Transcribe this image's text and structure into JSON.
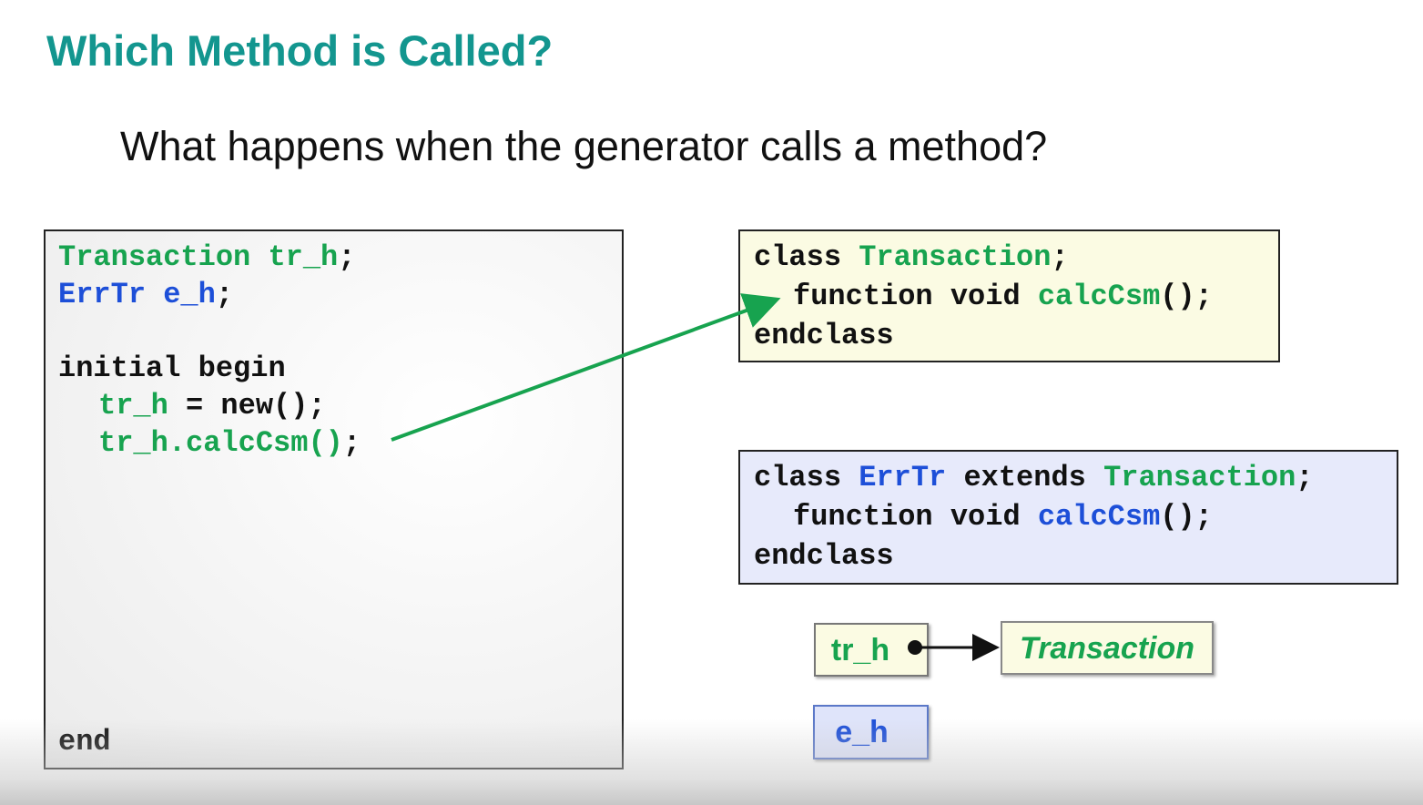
{
  "slide": {
    "title": "Which Method is Called?",
    "subtitle": "What happens when the generator calls a method?"
  },
  "left_code": {
    "line1": {
      "type": "Transaction",
      "var": "tr_h",
      "end": ";"
    },
    "line2": {
      "type": "ErrTr",
      "var": "e_h",
      "end": ";"
    },
    "line3": "initial begin",
    "line4": {
      "var": "tr_h",
      "rest": " = new();"
    },
    "line5": {
      "var": "tr_h",
      "call": ".calcCsm()",
      "end": ";"
    },
    "line6": "end"
  },
  "transaction_class": {
    "kw_class": "class",
    "name": "Transaction",
    "semi": ";",
    "fn_kw": "function void",
    "method": "calcCsm",
    "fn_end": "();",
    "endclass": "endclass"
  },
  "errtr_class": {
    "kw_class": "class",
    "name": "ErrTr",
    "extends_kw": "extends",
    "parent": "Transaction",
    "semi": ";",
    "fn_kw": "function void",
    "method": "calcCsm",
    "fn_end": "();",
    "endclass": "endclass"
  },
  "handles": {
    "tr_h_label": "tr_h",
    "e_h_label": "e_h",
    "object_label": "Transaction"
  },
  "colors": {
    "title": "#13968f",
    "transaction_green": "#17a34f",
    "errtr_blue": "#1d4fd8",
    "arrow": "#17a34f"
  }
}
